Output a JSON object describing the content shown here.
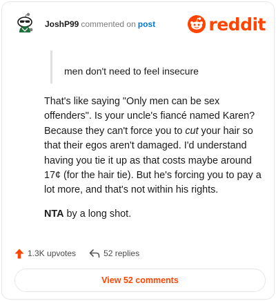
{
  "header": {
    "username": "JoshP99",
    "action_text": "commented on",
    "action_object": "post",
    "logo_text": "reddit",
    "brand_color": "#ff4500"
  },
  "comment": {
    "quote": "men don't need to feel insecure",
    "paragraph_1_a": "That's like saying \"Only men can be sex offenders\". Is your uncle's fiancé named Karen? Because they can't force you to ",
    "paragraph_1_em": "cut",
    "paragraph_1_b": " your hair so that their egos aren't damaged. I'd understand having you tie it up as that costs maybe around 17¢ (for the hair tie). But he's forcing you to pay a lot more, and that's not within his rights.",
    "verdict_bold": "NTA",
    "verdict_rest": " by a long shot."
  },
  "actions": {
    "upvotes": "1.3K upvotes",
    "replies": "52 replies"
  },
  "footer": {
    "view_button": "View 52 comments"
  },
  "icons": {
    "avatar": "snoo-avatar-icon",
    "logo": "reddit-snoo-icon",
    "upvote": "upvote-arrow-icon",
    "reply": "reply-arrow-icon"
  }
}
